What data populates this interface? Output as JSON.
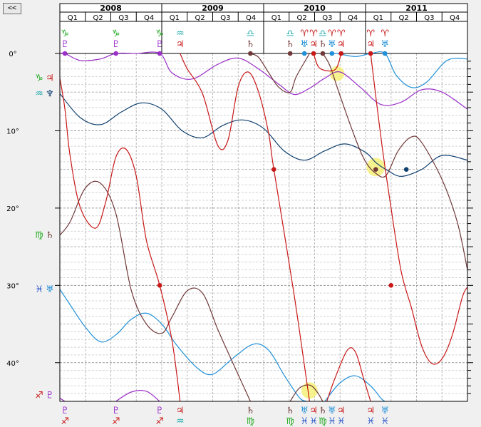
{
  "nav": {
    "back_label": "<<"
  },
  "chart_data": {
    "type": "line",
    "title": "",
    "years": [
      "2008",
      "2009",
      "2010",
      "2011"
    ],
    "quarters": [
      "Q1",
      "Q2",
      "Q3",
      "Q4"
    ],
    "x_range": [
      2008.0,
      2012.0
    ],
    "y_range": [
      0,
      45
    ],
    "y_ticks": [
      {
        "v": 0,
        "label": "0°"
      },
      {
        "v": 10,
        "label": "10°"
      },
      {
        "v": 20,
        "label": "20°"
      },
      {
        "v": 30,
        "label": "30°"
      },
      {
        "v": 40,
        "label": "40°"
      }
    ],
    "grid": true,
    "colors": {
      "pluto": "#9a30c8",
      "jupiter": "#c81818",
      "saturn": "#703838",
      "neptune": "#104070",
      "uranus": "#2090d8",
      "capricorn": "#22aa22",
      "aquarius": "#22aaaa",
      "libra": "#22aaaa",
      "aries": "#c81818",
      "virgo": "#22aa22",
      "pisces": "#2050c8",
      "sagittarius": "#c81818",
      "highlight": "#f5f07a"
    },
    "top_glyph_columns": [
      {
        "x": 2008.05,
        "sign": "♑",
        "sign_color": "capricorn",
        "planet": "♇",
        "planet_color": "pluto"
      },
      {
        "x": 2008.55,
        "sign": "♑",
        "sign_color": "capricorn",
        "planet": "♇",
        "planet_color": "pluto"
      },
      {
        "x": 2008.98,
        "sign": "♑",
        "sign_color": "capricorn",
        "planet": "♇",
        "planet_color": "pluto"
      },
      {
        "x": 2009.18,
        "sign": "♒",
        "sign_color": "aquarius",
        "planet": "♃",
        "planet_color": "jupiter"
      },
      {
        "x": 2009.87,
        "sign": "♎",
        "sign_color": "libra",
        "planet": "♄",
        "planet_color": "saturn"
      },
      {
        "x": 2010.26,
        "sign": "♎",
        "sign_color": "libra",
        "planet": "♄",
        "planet_color": "saturn"
      },
      {
        "x": 2010.4,
        "sign": "♈",
        "sign_color": "aries",
        "planet": "♅",
        "planet_color": "uranus"
      },
      {
        "x": 2010.49,
        "sign": "♈",
        "sign_color": "aries",
        "planet": "♃",
        "planet_color": "jupiter"
      },
      {
        "x": 2010.58,
        "sign": "♎",
        "sign_color": "libra",
        "planet": "♄",
        "planet_color": "saturn"
      },
      {
        "x": 2010.67,
        "sign": "♈",
        "sign_color": "aries",
        "planet": "♅",
        "planet_color": "uranus"
      },
      {
        "x": 2010.76,
        "sign": "♈",
        "sign_color": "aries",
        "planet": "♃",
        "planet_color": "jupiter"
      },
      {
        "x": 2011.05,
        "sign": "♈",
        "sign_color": "aries",
        "planet": "♃",
        "planet_color": "jupiter"
      },
      {
        "x": 2011.19,
        "sign": "♈",
        "sign_color": "aries",
        "planet": "♅",
        "planet_color": "uranus"
      }
    ],
    "bottom_glyph_columns": [
      {
        "x": 2008.05,
        "planet": "♇",
        "planet_color": "pluto",
        "sign": "♐",
        "sign_color": "sagittarius"
      },
      {
        "x": 2008.55,
        "planet": "♇",
        "planet_color": "pluto",
        "sign": "♐",
        "sign_color": "sagittarius"
      },
      {
        "x": 2008.98,
        "planet": "♇",
        "planet_color": "pluto",
        "sign": "♐",
        "sign_color": "sagittarius"
      },
      {
        "x": 2009.18,
        "planet": "♃",
        "planet_color": "jupiter",
        "sign": "♒",
        "sign_color": "aquarius"
      },
      {
        "x": 2009.87,
        "planet": "♄",
        "planet_color": "saturn",
        "sign": "♍",
        "sign_color": "virgo"
      },
      {
        "x": 2010.26,
        "planet": "♄",
        "planet_color": "saturn",
        "sign": "♍",
        "sign_color": "virgo"
      },
      {
        "x": 2010.4,
        "planet": "♅",
        "planet_color": "uranus",
        "sign": "♓",
        "sign_color": "pisces"
      },
      {
        "x": 2010.49,
        "planet": "♃",
        "planet_color": "jupiter",
        "sign": "♓",
        "sign_color": "pisces"
      },
      {
        "x": 2010.58,
        "planet": "♄",
        "planet_color": "saturn",
        "sign": "♍",
        "sign_color": "virgo"
      },
      {
        "x": 2010.67,
        "planet": "♅",
        "planet_color": "uranus",
        "sign": "♓",
        "sign_color": "pisces"
      },
      {
        "x": 2010.76,
        "planet": "♃",
        "planet_color": "jupiter",
        "sign": "♓",
        "sign_color": "pisces"
      },
      {
        "x": 2011.05,
        "planet": "♃",
        "planet_color": "jupiter",
        "sign": "♓",
        "sign_color": "pisces"
      },
      {
        "x": 2011.19,
        "planet": "♅",
        "planet_color": "uranus",
        "sign": "♓",
        "sign_color": "pisces"
      }
    ],
    "left_labels": [
      {
        "y": 3.2,
        "sign": "♑",
        "sign_color": "capricorn",
        "planet": "♃",
        "planet_color": "jupiter"
      },
      {
        "y": 5.2,
        "sign": "♒",
        "sign_color": "aquarius",
        "planet": "♆",
        "planet_color": "neptune"
      },
      {
        "y": 23.5,
        "sign": "♍",
        "sign_color": "virgo",
        "planet": "♄",
        "planet_color": "saturn"
      },
      {
        "y": 30.5,
        "sign": "♓",
        "sign_color": "pisces",
        "planet": "♅",
        "planet_color": "uranus"
      },
      {
        "y": 44.2,
        "sign": "♐",
        "sign_color": "sagittarius",
        "planet": "♇",
        "planet_color": "pluto"
      }
    ],
    "series": [
      {
        "name": "Pluto",
        "color": "pluto",
        "points": [
          [
            2008.0,
            0.0
          ],
          [
            2008.05,
            0.0
          ],
          [
            2008.2,
            0.9
          ],
          [
            2008.4,
            0.7
          ],
          [
            2008.55,
            0.0
          ],
          [
            2008.75,
            0.0
          ],
          [
            2008.98,
            0.0
          ],
          [
            2009.1,
            2.5
          ],
          [
            2009.3,
            3.3
          ],
          [
            2009.55,
            1.4
          ],
          [
            2009.75,
            0.6
          ],
          [
            2009.95,
            2.0
          ],
          [
            2010.15,
            4.0
          ],
          [
            2010.3,
            5.3
          ],
          [
            2010.45,
            4.5
          ],
          [
            2010.6,
            3.2
          ],
          [
            2010.75,
            2.4
          ],
          [
            2010.95,
            4.4
          ],
          [
            2011.15,
            6.6
          ],
          [
            2011.35,
            6.3
          ],
          [
            2011.55,
            4.7
          ],
          [
            2011.75,
            5.0
          ],
          [
            2012.0,
            7.2
          ]
        ]
      },
      {
        "name": "Pluto",
        "color": "pluto",
        "points": [
          [
            2008.0,
            44.6
          ],
          [
            2008.05,
            45.0
          ]
        ]
      },
      {
        "name": "Pluto",
        "color": "pluto",
        "points": [
          [
            2008.55,
            45.0
          ],
          [
            2008.7,
            43.8
          ],
          [
            2008.85,
            43.7
          ],
          [
            2008.98,
            45.0
          ]
        ]
      },
      {
        "name": "Neptune",
        "color": "neptune",
        "points": [
          [
            2008.0,
            5.2
          ],
          [
            2008.2,
            8.3
          ],
          [
            2008.4,
            9.2
          ],
          [
            2008.6,
            7.6
          ],
          [
            2008.8,
            6.4
          ],
          [
            2009.0,
            7.2
          ],
          [
            2009.2,
            10.0
          ],
          [
            2009.4,
            10.9
          ],
          [
            2009.6,
            9.3
          ],
          [
            2009.8,
            8.6
          ],
          [
            2010.0,
            9.7
          ],
          [
            2010.2,
            12.6
          ],
          [
            2010.4,
            13.8
          ],
          [
            2010.6,
            12.6
          ],
          [
            2010.8,
            11.7
          ],
          [
            2011.0,
            12.8
          ],
          [
            2011.1,
            14.1
          ],
          [
            2011.2,
            15.0
          ],
          [
            2011.35,
            15.9
          ],
          [
            2011.55,
            15.0
          ],
          [
            2011.75,
            13.2
          ],
          [
            2012.0,
            13.8
          ]
        ]
      },
      {
        "name": "Uranus",
        "color": "uranus",
        "points": [
          [
            2008.0,
            30.5
          ],
          [
            2008.1,
            32.5
          ],
          [
            2008.25,
            35.4
          ],
          [
            2008.4,
            37.3
          ],
          [
            2008.55,
            36.4
          ],
          [
            2008.7,
            34.4
          ],
          [
            2008.85,
            33.6
          ],
          [
            2009.0,
            35.0
          ],
          [
            2009.15,
            37.8
          ],
          [
            2009.35,
            40.7
          ],
          [
            2009.5,
            41.5
          ],
          [
            2009.7,
            39.4
          ],
          [
            2009.9,
            37.6
          ],
          [
            2010.05,
            38.4
          ],
          [
            2010.2,
            41.6
          ],
          [
            2010.35,
            44.5
          ],
          [
            2010.42,
            45.0
          ]
        ]
      },
      {
        "name": "Uranus",
        "color": "uranus",
        "points": [
          [
            2010.6,
            45.0
          ],
          [
            2010.75,
            42.6
          ],
          [
            2010.9,
            41.7
          ],
          [
            2011.05,
            43.0
          ],
          [
            2011.15,
            44.6
          ],
          [
            2011.19,
            45.0
          ]
        ]
      },
      {
        "name": "Uranus",
        "color": "uranus",
        "points": [
          [
            2010.65,
            0.0
          ],
          [
            2010.72,
            0.0
          ],
          [
            2010.9,
            0.4
          ],
          [
            2011.05,
            0.0
          ],
          [
            2011.19,
            0.0
          ],
          [
            2011.3,
            2.8
          ],
          [
            2011.45,
            4.4
          ],
          [
            2011.6,
            3.7
          ],
          [
            2011.8,
            0.9
          ],
          [
            2012.0,
            0.7
          ]
        ]
      },
      {
        "name": "Saturn",
        "color": "saturn",
        "points": [
          [
            2008.0,
            23.5
          ],
          [
            2008.1,
            21.8
          ],
          [
            2008.25,
            17.4
          ],
          [
            2008.4,
            16.8
          ],
          [
            2008.55,
            20.7
          ],
          [
            2008.7,
            30.6
          ],
          [
            2008.85,
            35.0
          ],
          [
            2009.0,
            36.2
          ],
          [
            2009.1,
            34.1
          ],
          [
            2009.25,
            30.7
          ],
          [
            2009.4,
            31.0
          ],
          [
            2009.55,
            35.7
          ],
          [
            2009.7,
            40.1
          ],
          [
            2009.87,
            45.0
          ]
        ]
      },
      {
        "name": "Saturn",
        "color": "saturn",
        "points": [
          [
            2009.87,
            0.0
          ],
          [
            2009.95,
            0.5
          ],
          [
            2010.05,
            2.5
          ],
          [
            2010.15,
            4.4
          ],
          [
            2010.26,
            5.0
          ],
          [
            2010.32,
            3.0
          ],
          [
            2010.45,
            0.0
          ]
        ]
      },
      {
        "name": "Saturn",
        "color": "saturn",
        "points": [
          [
            2010.26,
            45.0
          ],
          [
            2010.35,
            43.3
          ],
          [
            2010.45,
            42.9
          ],
          [
            2010.52,
            43.7
          ],
          [
            2010.58,
            45.0
          ]
        ]
      },
      {
        "name": "Saturn",
        "color": "saturn",
        "points": [
          [
            2010.58,
            0.0
          ],
          [
            2010.65,
            1.6
          ],
          [
            2010.75,
            5.5
          ],
          [
            2010.9,
            11.0
          ],
          [
            2011.0,
            14.0
          ],
          [
            2011.1,
            15.5
          ],
          [
            2011.2,
            15.8
          ],
          [
            2011.32,
            12.6
          ],
          [
            2011.45,
            10.8
          ],
          [
            2011.55,
            11.5
          ],
          [
            2011.75,
            16.3
          ],
          [
            2011.9,
            21.8
          ],
          [
            2012.0,
            28.0
          ]
        ]
      },
      {
        "name": "Jupiter",
        "color": "jupiter",
        "points": [
          [
            2008.0,
            3.2
          ],
          [
            2008.05,
            7.2
          ],
          [
            2008.1,
            13.2
          ],
          [
            2008.2,
            19.9
          ],
          [
            2008.35,
            22.6
          ],
          [
            2008.45,
            19.2
          ],
          [
            2008.55,
            13.4
          ],
          [
            2008.65,
            12.4
          ],
          [
            2008.75,
            15.9
          ],
          [
            2008.85,
            24.2
          ],
          [
            2008.98,
            30.0
          ],
          [
            2009.1,
            37.1
          ],
          [
            2009.18,
            45.0
          ]
        ]
      },
      {
        "name": "Jupiter",
        "color": "jupiter",
        "points": [
          [
            2009.18,
            0.0
          ],
          [
            2009.25,
            2.0
          ],
          [
            2009.4,
            5.2
          ],
          [
            2009.55,
            11.9
          ],
          [
            2009.65,
            11.2
          ],
          [
            2009.75,
            4.3
          ],
          [
            2009.85,
            2.4
          ],
          [
            2009.95,
            5.0
          ],
          [
            2010.05,
            10.4
          ],
          [
            2010.1,
            15.0
          ],
          [
            2010.3,
            31.3
          ],
          [
            2010.45,
            45.0
          ]
        ]
      },
      {
        "name": "Jupiter",
        "color": "jupiter",
        "points": [
          [
            2010.49,
            0.0
          ],
          [
            2010.55,
            1.9
          ],
          [
            2010.7,
            2.1
          ],
          [
            2010.76,
            0.0
          ]
        ]
      },
      {
        "name": "Jupiter",
        "color": "jupiter",
        "points": [
          [
            2010.62,
            45.0
          ],
          [
            2010.7,
            42.0
          ],
          [
            2010.82,
            38.4
          ],
          [
            2010.9,
            38.6
          ],
          [
            2010.98,
            42.0
          ],
          [
            2011.05,
            45.0
          ]
        ]
      },
      {
        "name": "Jupiter",
        "color": "jupiter",
        "points": [
          [
            2011.05,
            0.0
          ],
          [
            2011.15,
            10.8
          ],
          [
            2011.25,
            20.0
          ],
          [
            2011.35,
            28.2
          ],
          [
            2011.45,
            32.9
          ],
          [
            2011.55,
            37.8
          ],
          [
            2011.65,
            40.1
          ],
          [
            2011.75,
            39.5
          ],
          [
            2011.85,
            36.5
          ],
          [
            2011.95,
            31.5
          ],
          [
            2012.0,
            30.2
          ]
        ]
      }
    ],
    "markers": [
      {
        "x": 2008.05,
        "y": 0,
        "color": "pluto"
      },
      {
        "x": 2008.55,
        "y": 0,
        "color": "pluto"
      },
      {
        "x": 2008.98,
        "y": 0,
        "color": "pluto"
      },
      {
        "x": 2008.98,
        "y": 30,
        "color": "jupiter"
      },
      {
        "x": 2009.87,
        "y": 0,
        "color": "saturn"
      },
      {
        "x": 2010.1,
        "y": 15,
        "color": "jupiter"
      },
      {
        "x": 2010.26,
        "y": 0,
        "color": "saturn"
      },
      {
        "x": 2010.4,
        "y": 0,
        "color": "uranus"
      },
      {
        "x": 2010.49,
        "y": 0,
        "color": "jupiter"
      },
      {
        "x": 2010.58,
        "y": 0,
        "color": "saturn"
      },
      {
        "x": 2010.67,
        "y": 0,
        "color": "uranus"
      },
      {
        "x": 2010.76,
        "y": 0,
        "color": "jupiter"
      },
      {
        "x": 2011.05,
        "y": 0,
        "color": "jupiter"
      },
      {
        "x": 2011.19,
        "y": 0,
        "color": "uranus"
      },
      {
        "x": 2011.1,
        "y": 15,
        "color": "saturn"
      },
      {
        "x": 2011.4,
        "y": 15,
        "color": "neptune"
      },
      {
        "x": 2011.25,
        "y": 30,
        "color": "jupiter"
      }
    ],
    "highlights": [
      {
        "x": 2010.72,
        "y": 2.6,
        "r": 0.29
      },
      {
        "x": 2011.1,
        "y": 14.7,
        "r": 0.36
      },
      {
        "x": 2010.45,
        "y": 43.6,
        "r": 0.32
      }
    ]
  }
}
